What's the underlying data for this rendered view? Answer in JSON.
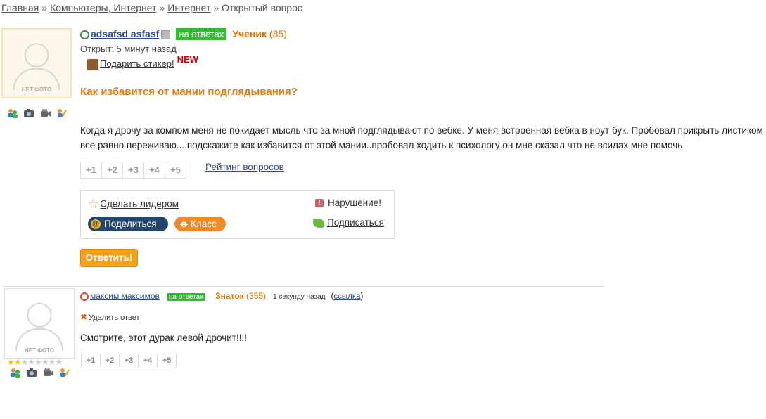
{
  "breadcrumb": {
    "items": [
      "Главная",
      "Компьютеры, Интернет",
      "Интернет"
    ],
    "separator": "»",
    "current": "Открытый вопрос"
  },
  "question": {
    "avatar_caption": "НЕТ ФОТО",
    "author": "adsafsd asfasf",
    "status_badge": "на ответах",
    "rank_label": "Ученик",
    "rank_points": "(85)",
    "opened": "Открыт: 5 минут назад",
    "gift_link": "Подарить стикер!",
    "new_badge": "NEW",
    "title": "Как избавится от мании подглядывания?",
    "body": "Когда я дрочу за компом меня не покидает мысль что за мной подглядывают по вебке. У меня встроенная вебка в ноут бук. Пробовал прикрыть листиком все равно переживаю....подскажите как избавится от этой мании..пробовал ходить к психологу он мне сказал что не всилах мне помочь",
    "rating_buttons": [
      "+1",
      "+2",
      "+3",
      "+4",
      "+5"
    ],
    "rating_link": "Рейтинг вопросов",
    "actions": {
      "make_leader": "Сделать лидером",
      "violation": "Нарушение!",
      "subscribe": "Подписаться",
      "share": "Поделиться",
      "klass": "Класс"
    },
    "answer_button": "Ответить!"
  },
  "answer": {
    "avatar_caption": "НЕТ ФОТО",
    "author": "максим максимов",
    "status_badge": "на ответах",
    "rank_label": "Знаток",
    "rank_points": "(355)",
    "time_ago": "1 секунду назад",
    "link_label": "ссылка",
    "delete_link": "Удалить ответ",
    "body": "Смотрите, этот дурак левой дрочит!!!!",
    "rating_buttons": [
      "+1",
      "+2",
      "+3",
      "+4",
      "+5"
    ],
    "stars_filled": 2,
    "stars_total": 8
  },
  "colors": {
    "accent_orange": "#e57b0e",
    "link_blue": "#2a4a8e",
    "badge_green": "#2fbd2f",
    "share_navy": "#24466e",
    "klass_orange": "#f08a24",
    "answer_button": "#f9a01b"
  }
}
